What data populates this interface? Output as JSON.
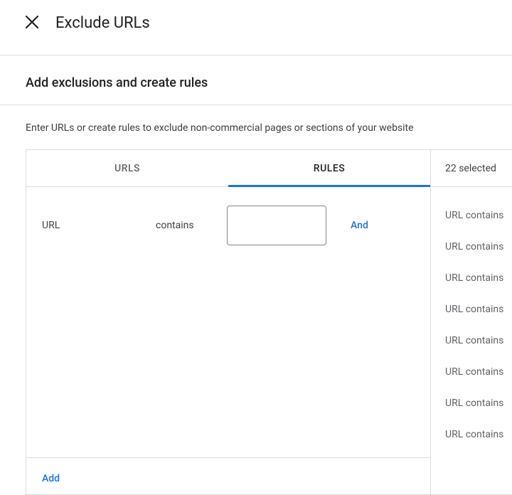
{
  "header": {
    "title": "Exclude URLs"
  },
  "subheading": "Add exclusions and create rules",
  "instruction": "Enter URLs or create rules to exclude non-commercial pages or sections of your website",
  "tabs": {
    "urls": "URLS",
    "rules": "RULES"
  },
  "rule": {
    "field": "URL",
    "operator": "contains",
    "value": "",
    "conjunction": "And"
  },
  "actions": {
    "add": "Add"
  },
  "selected": {
    "count_label": "22 selected",
    "items": [
      "URL contains",
      "URL contains",
      "URL contains",
      "URL contains",
      "URL contains",
      "URL contains",
      "URL contains",
      "URL contains"
    ]
  }
}
